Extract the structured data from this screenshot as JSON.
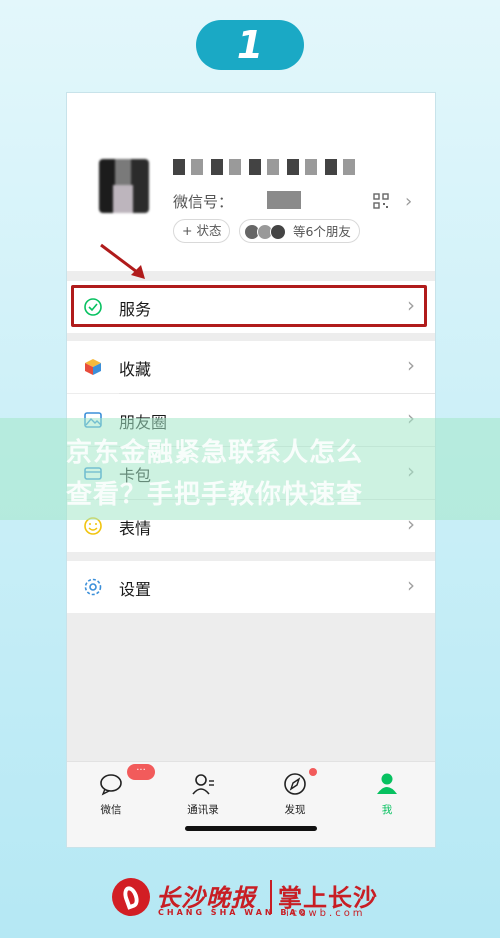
{
  "step": "1",
  "profile": {
    "wechat_id_label": "微信号：",
    "status_chip": "+ 状态",
    "friends_chip": "等6个朋友",
    "chevron": "›"
  },
  "menu": {
    "services": "服务",
    "favorites": "收藏",
    "moments": "朋友圈",
    "cards": "卡包",
    "stickers": "表情",
    "settings": "设置"
  },
  "watermark": {
    "line1": "京东金融紧急联系人怎么",
    "line2": "查看？手把手教你快速查"
  },
  "tabbar": {
    "chats": "微信",
    "contacts": "通讯录",
    "discover": "发现",
    "me": "我",
    "chats_badge": "···"
  },
  "footer": {
    "brand": "长沙晚报",
    "brand_pinyin": "CHANG SHA WAN BAO",
    "app": "掌上长沙",
    "url": "icswb.com"
  },
  "colors": {
    "accent": "#1aa9c5",
    "wechat_green": "#07c160",
    "highlight_red": "#b01b1b",
    "badge_red": "#f25b5b"
  }
}
